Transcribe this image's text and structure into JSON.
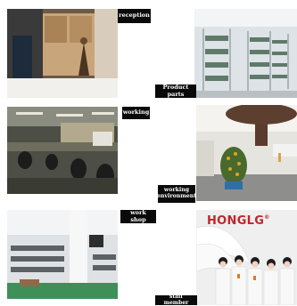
{
  "sections": [
    {
      "left": {
        "label": "reception",
        "scene": "office-reception-photo"
      },
      "right": {
        "label": "Product parts",
        "scene": "warehouse-shelves-photo"
      }
    },
    {
      "left": {
        "label": "working",
        "scene": "assembly-line-photo"
      },
      "right": {
        "label": "working\nenvironment",
        "scene": "office-lobby-tree-photo"
      }
    },
    {
      "left": {
        "label": "work shop",
        "scene": "factory-floor-photo"
      },
      "right": {
        "label": "staff member",
        "scene": "team-photo",
        "brand_text": "HONGLG",
        "brand_mark": "®"
      }
    }
  ],
  "colors": {
    "label_bg": "#0a0a0a",
    "label_text": "#ffffff",
    "brand_red": "#c0262c"
  }
}
